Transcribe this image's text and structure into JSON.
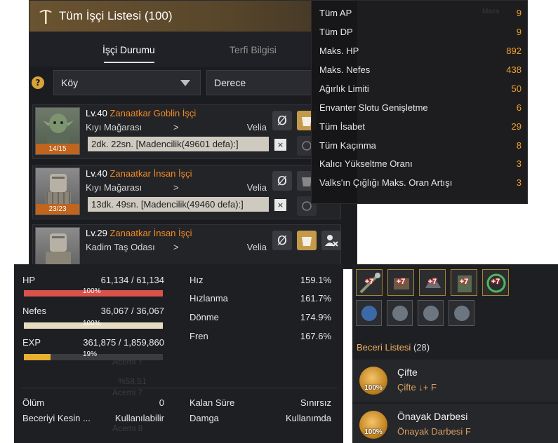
{
  "worker_list": {
    "title": "Tüm İşçi Listesi (100)",
    "tabs": [
      {
        "label": "İşçi Durumu",
        "active": true
      },
      {
        "label": "Terfi Bilgisi",
        "active": false
      }
    ],
    "help_label": "?",
    "filter_region": "Köy",
    "filter_grade": "Derece",
    "skip_symbol": "Ø",
    "workers": [
      {
        "level": "Lv.40",
        "name": "Zanaatkar Goblin İşçi",
        "location": "Kıyı Mağarası",
        "arrow": ">",
        "destination": "Velia",
        "stamina": "14/15",
        "task_prefix": "2dk. 22sn. [Madencilik(49601 defa):]",
        "close": "×",
        "portrait": "goblin"
      },
      {
        "level": "Lv.40",
        "name": "Zanaatkar İnsan İşçi",
        "location": "Kıyı Mağarası",
        "arrow": ">",
        "destination": "Velia",
        "stamina": "23/23",
        "task_prefix": "13dk. 49sn. [Madencilik(49460 defa):]",
        "close": "×",
        "portrait": "human"
      },
      {
        "level": "Lv.29",
        "name": "Zanaatkar İnsan İşçi",
        "location": "Kadim Taş Odası",
        "arrow": ">",
        "destination": "Velia",
        "stamina": "",
        "task_prefix": "",
        "close": "",
        "portrait": "human"
      }
    ]
  },
  "stats_tooltip": {
    "ghost_text": "Maca",
    "rows": [
      {
        "label": "Tüm AP",
        "value": "9"
      },
      {
        "label": "Tüm DP",
        "value": "9"
      },
      {
        "label": "Maks. HP",
        "value": "892"
      },
      {
        "label": "Maks. Nefes",
        "value": "438"
      },
      {
        "label": "Ağırlık Limiti",
        "value": "50"
      },
      {
        "label": "Envanter Slotu Genişletme",
        "value": "6"
      },
      {
        "label": "Tüm İsabet",
        "value": "29"
      },
      {
        "label": "Tüm Kaçınma",
        "value": "8"
      },
      {
        "label": "Kalıcı Yükseltme Oranı",
        "value": "3"
      },
      {
        "label": "Valks'ın Çığlığı Maks. Oran Artışı",
        "value": "3"
      }
    ]
  },
  "character_stats": {
    "hp": {
      "label": "HP",
      "current": "61,134",
      "sep": "/",
      "max": "61,134",
      "pct_text": "100%",
      "fill": 1.0,
      "color": "#d9534a"
    },
    "nefes": {
      "label": "Nefes",
      "current": "36,067",
      "sep": "/",
      "max": "36,067",
      "pct_text": "100%",
      "fill": 1.0,
      "color": "#e6dcc2"
    },
    "exp": {
      "label": "EXP",
      "current": "361,875",
      "sep": "/",
      "max": "1,859,860",
      "pct_text": "19%",
      "fill": 0.19,
      "color": "#e8b030"
    },
    "speeds": [
      {
        "label": "Hız",
        "value": "159.1%"
      },
      {
        "label": "Hızlanma",
        "value": "161.7%"
      },
      {
        "label": "Dönme",
        "value": "174.9%"
      },
      {
        "label": "Fren",
        "value": "167.6%"
      }
    ],
    "ghost_a": "Acemi 7",
    "ghost_b": "%58.51",
    "ghost_c": "Acemi 7",
    "ghost_d": "Acemi 8",
    "death_label": "Ölüm",
    "death_value": "0",
    "remaining_label": "Kalan Süre",
    "remaining_value": "Sınırsız",
    "skill_cut_label": "Beceriyi Kesin ...",
    "skill_cut_value": "Kullanılabilir",
    "stamp_label": "Damga",
    "stamp_value": "Kullanımda"
  },
  "equipment": {
    "top_slots": [
      {
        "enchant": "+7"
      },
      {
        "enchant": "+7"
      },
      {
        "enchant": "+7"
      },
      {
        "enchant": "+7"
      },
      {
        "enchant": "+7"
      }
    ],
    "bottom_slots": [
      {
        "enchant": ""
      },
      {
        "enchant": ""
      },
      {
        "enchant": ""
      },
      {
        "enchant": ""
      }
    ]
  },
  "skills": {
    "header": "Beceri Listesi",
    "count": "(28)",
    "items": [
      {
        "name": "Çifte",
        "keys": "Çifte ↓+ F",
        "pct": "100%"
      },
      {
        "name": "Önayak Darbesi",
        "keys": "Önayak Darbesi F",
        "pct": "100%"
      }
    ]
  },
  "colors": {
    "accent_orange": "#f08a24",
    "value_gold": "#f0a030",
    "title_bar": "#6a5330"
  }
}
